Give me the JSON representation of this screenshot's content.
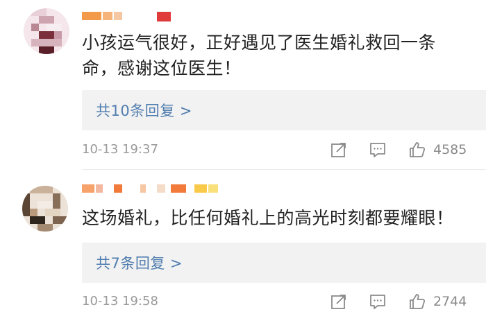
{
  "comments": [
    {
      "text": "小孩运气很好，正好遇见了医生婚礼救回一条命，感谢这位医生！",
      "reply_link": "共10条回复 >",
      "timestamp": "10-13 19:37",
      "likes": "4585",
      "icons": {
        "share": "share-icon",
        "reply": "comment-icon",
        "like": "thumbs-up-icon"
      },
      "avatar_colors": [
        "#f3e0e6",
        "#d9b8c3",
        "#7a2f3a",
        "#f7eef1",
        "#c99aa8",
        "#5a1f28"
      ],
      "username_colors": [
        "#f2994a",
        "#f6b37a",
        "#e03b3b"
      ]
    },
    {
      "text": "这场婚礼，比任何婚礼上的高光时刻都要耀眼！",
      "reply_link": "共7条回复 >",
      "timestamp": "10-13 19:58",
      "likes": "2744",
      "icons": {
        "share": "share-icon",
        "reply": "comment-icon",
        "like": "thumbs-up-icon"
      },
      "avatar_colors": [
        "#e8d9c9",
        "#b99a7d",
        "#5b4636",
        "#f3ece4",
        "#8a6f58",
        "#2f261e"
      ],
      "username_colors": [
        "#f7a26b",
        "#f27a3a",
        "#f9c94a",
        "#f4b7a0"
      ]
    }
  ]
}
